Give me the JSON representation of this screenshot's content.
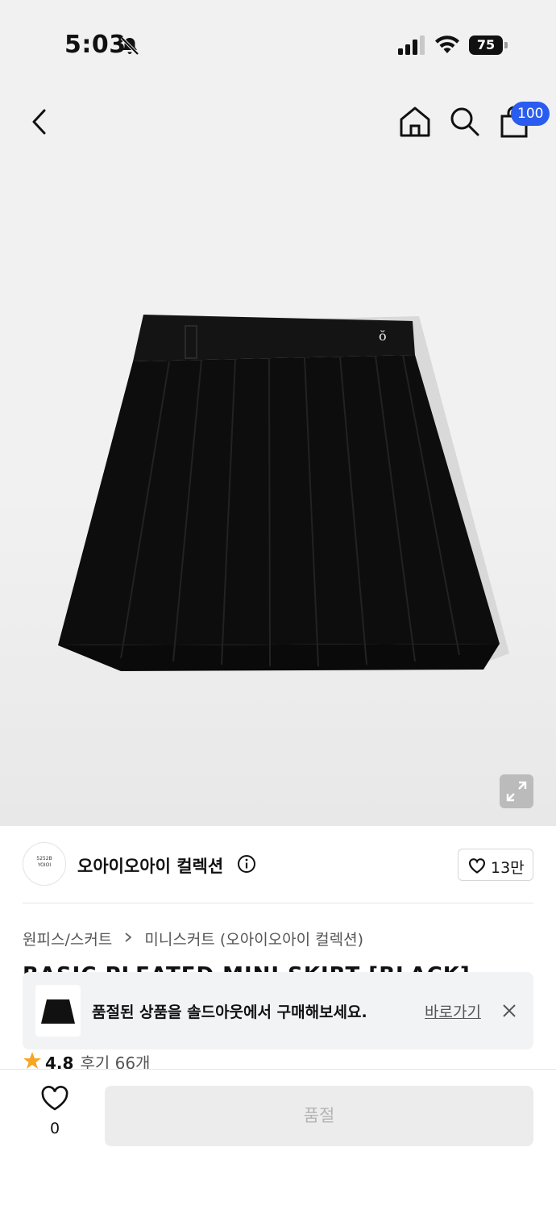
{
  "status_bar": {
    "time": "5:03",
    "battery": "75",
    "icons": [
      "bell-off-icon",
      "signal-icon",
      "wifi-icon",
      "battery-icon"
    ]
  },
  "nav": {
    "icons": [
      "back-icon",
      "home-icon",
      "search-icon",
      "cart-icon",
      "expand-icon"
    ],
    "cart_badge": "100"
  },
  "brand": {
    "logo_line1": "5252B",
    "logo_line2": "YOIOI",
    "name": "오아이오아이 컬렉션",
    "likes": "13만"
  },
  "breadcrumb": {
    "category1": "원피스/스커트",
    "category2": "미니스커트 (오아이오아이 컬렉션)"
  },
  "product": {
    "title": "BASIC PLEATED MINI SKIRT [BLACK]"
  },
  "toast": {
    "message": "품절된 상품을 솔드아웃에서 구매해보세요.",
    "link": "바로가기"
  },
  "rating": {
    "score": "4.8",
    "reviews": "후기 66개"
  },
  "bottom_bar": {
    "wish_count": "0",
    "soldout_label": "품절"
  },
  "colors": {
    "badge": "#2a5cf0",
    "star": "#f5a623",
    "disabled_button": "#ececec"
  }
}
